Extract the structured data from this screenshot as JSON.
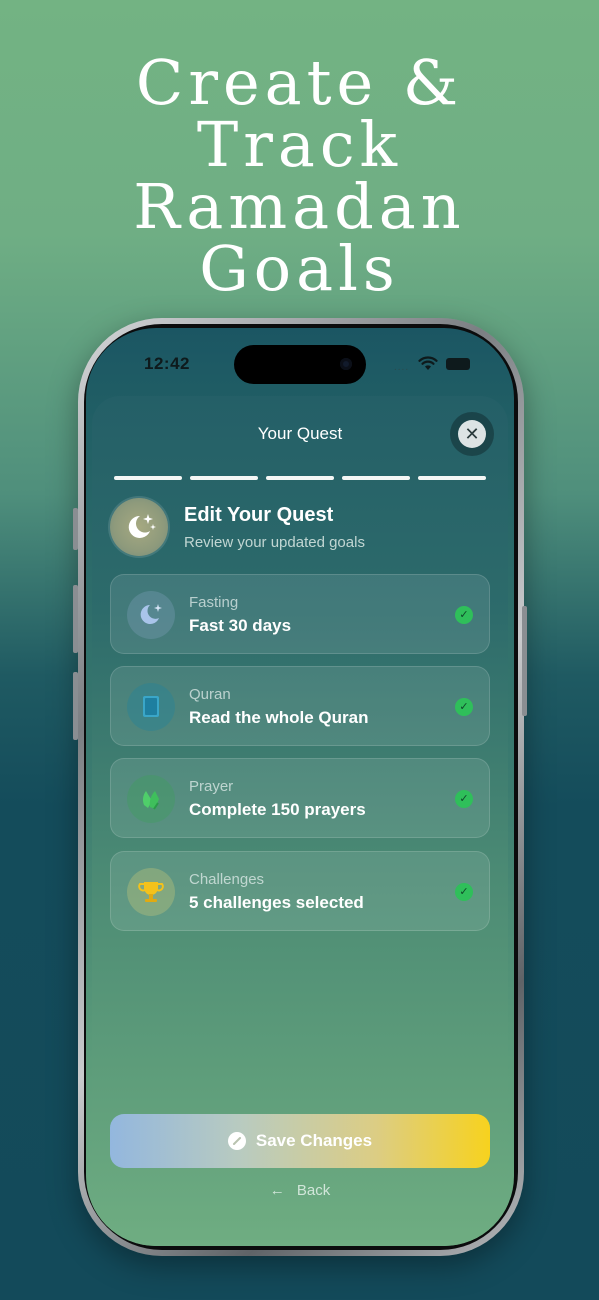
{
  "headline": [
    "Create &",
    "Track",
    "Ramadan",
    "Goals"
  ],
  "status_bar": {
    "time": "12:42",
    "signal_dots": "...."
  },
  "sheet": {
    "title": "Your Quest",
    "close_icon": "close-icon",
    "progress_steps_total": 5,
    "progress_steps_complete": 5
  },
  "header": {
    "title": "Edit Your Quest",
    "subtitle": "Review your updated goals",
    "icon": "moon-stars-icon"
  },
  "goals": [
    {
      "label": "Fasting",
      "value": "Fast 30 days",
      "icon": "moon-stars-icon",
      "status": "complete"
    },
    {
      "label": "Quran",
      "value": "Read the whole Quran",
      "icon": "book-icon",
      "status": "complete"
    },
    {
      "label": "Prayer",
      "value": "Complete 150 prayers",
      "icon": "praying-hands-icon",
      "status": "complete"
    },
    {
      "label": "Challenges",
      "value": "5 challenges selected",
      "icon": "trophy-icon",
      "status": "complete"
    }
  ],
  "actions": {
    "save_label": "Save Changes",
    "back_label": "Back"
  },
  "colors": {
    "accent_start": "#93b7de",
    "accent_end": "#f7d21e",
    "check_green": "#2fbf5a"
  }
}
